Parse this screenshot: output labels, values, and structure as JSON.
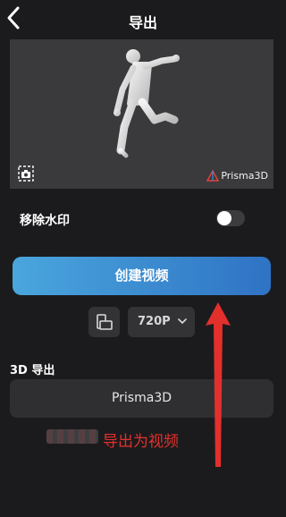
{
  "header": {
    "title": "导出",
    "back_icon": "chevron-left-icon"
  },
  "preview": {
    "brand_label": "Prisma3D",
    "snapshot_icon": "camera-icon",
    "brand_icon": "prisma-logo-icon"
  },
  "watermark": {
    "label": "移除水印",
    "enabled": false
  },
  "create_video": {
    "label": "创建视频"
  },
  "options": {
    "ratio_icon": "aspect-ratio-icon",
    "resolution": "720P",
    "chevron_icon": "chevron-down-icon"
  },
  "export3d": {
    "section_title": "3D 导出",
    "button_label": "Prisma3D"
  },
  "annotation": {
    "text": "导出为视频"
  },
  "colors": {
    "accent_start": "#4aa6dd",
    "accent_end": "#2f73c4",
    "annotation": "#e3302c",
    "background": "#1b1b1d"
  }
}
